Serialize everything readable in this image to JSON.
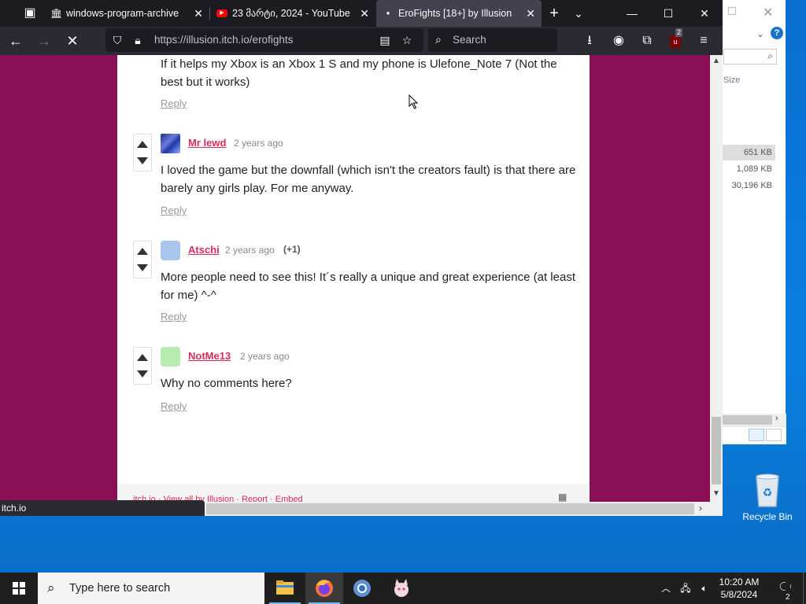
{
  "tabs": [
    {
      "label": "windows-program-archive",
      "icon": "archive-icon",
      "active": false
    },
    {
      "label": "23 მარტი, 2024 - YouTube",
      "icon": "youtube-icon",
      "active": false
    },
    {
      "label": "EroFights [18+] by Illusion",
      "icon": "itch-icon",
      "active": true
    }
  ],
  "toolbar": {
    "url": "https://illusion.itch.io/erofights",
    "search_placeholder": "Search",
    "ublock_badge": "2"
  },
  "comments": [
    {
      "author": "",
      "time": "",
      "votes": "",
      "body": "If it helps my Xbox is an Xbox 1 S and my phone is Ulefone_Note 7 (Not the best but it works)",
      "reply": "Reply"
    },
    {
      "author": "Mr lewd",
      "time": "2 years ago",
      "votes": "",
      "body": "I loved the game but the downfall (which isn't the creators fault) is that there are barely any girls play. For me anyway.",
      "reply": "Reply"
    },
    {
      "author": "Atschi",
      "time": "2 years ago",
      "votes": "(+1)",
      "body": "More people need to see this! It´s really a unique and great experience (at least for me) ^-^",
      "reply": "Reply"
    },
    {
      "author": "NotMe13",
      "time": "2 years ago",
      "votes": "",
      "body": "Why no comments here?",
      "reply": "Reply"
    }
  ],
  "footer": {
    "text": "itch.io · View all by Illusion · Report · Embed"
  },
  "status_link": "itch.io",
  "explorer": {
    "size_header": "Size",
    "sizes": [
      "651 KB",
      "1,089 KB",
      "30,196 KB"
    ]
  },
  "desktop": {
    "recycle_bin": "Recycle Bin"
  },
  "taskbar": {
    "search_placeholder": "Type here to search",
    "time": "10:20 AM",
    "date": "5/8/2024",
    "notifications": "2"
  },
  "colors": {
    "page_bg": "#8b0f55",
    "link": "#da2c5a",
    "firefox_dark": "#1c1b22"
  }
}
